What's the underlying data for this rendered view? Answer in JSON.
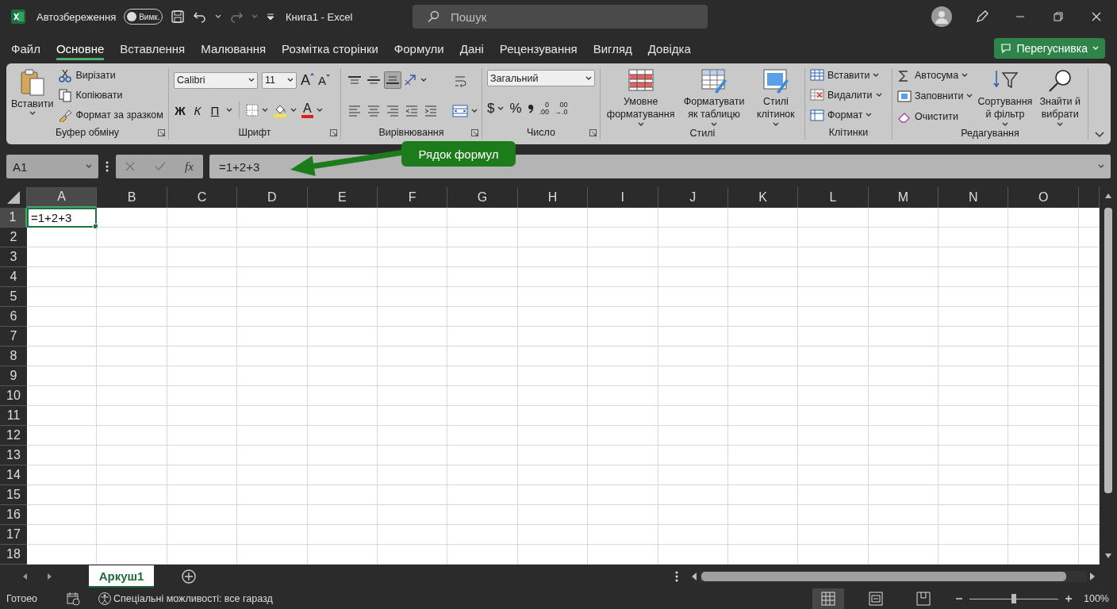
{
  "title_bar": {
    "autosave_label": "Автозбереження",
    "autosave": {
      "label": "Вимк.",
      "on": false
    },
    "title": "Книга1 - Excel",
    "search": {
      "placeholder": "Пошук"
    }
  },
  "menu_tabs": [
    {
      "label": "Файл",
      "selected": false
    },
    {
      "label": "Основне",
      "selected": true
    },
    {
      "label": "Вставлення",
      "selected": false
    },
    {
      "label": "Малювання",
      "selected": false
    },
    {
      "label": "Розмітка сторінки",
      "selected": false
    },
    {
      "label": "Формули",
      "selected": false
    },
    {
      "label": "Дані",
      "selected": false
    },
    {
      "label": "Рецензування",
      "selected": false
    },
    {
      "label": "Вигляд",
      "selected": false
    },
    {
      "label": "Довідка",
      "selected": false
    }
  ],
  "share_button": {
    "label": "Перегуснивка"
  },
  "ribbon": {
    "groups": [
      {
        "kind": "clipboard",
        "label": "Буфер обміну",
        "launcher": true,
        "paste": "Вставити",
        "actions": [
          "Вирізати",
          "Копіювати",
          "Формат за зразком"
        ]
      },
      {
        "kind": "font",
        "label": "Шрифт",
        "launcher": true,
        "font_name": "Calibri",
        "font_size": "11",
        "grow": "A",
        "shrink": "A",
        "styles": [
          "Ж",
          "К",
          "П"
        ],
        "font_color": "A"
      },
      {
        "kind": "alignment",
        "label": "Вирівнювання",
        "launcher": true,
        "vertical": [
          {
            "selected": false
          },
          {
            "selected": false
          },
          {
            "selected": true
          }
        ]
      },
      {
        "kind": "number",
        "label": "Число",
        "launcher": true,
        "format": "Загальний",
        "currency": "$",
        "percent": "%",
        "decimals": [
          "0\n.00",
          "00\n→.0"
        ]
      },
      {
        "kind": "styles",
        "label": "Стилі",
        "launcher": false,
        "buttons": [
          "Умовне форматування",
          "Форматувати як таблицю",
          "Стилі клітинок"
        ]
      },
      {
        "kind": "cells",
        "label": "Клітинки",
        "launcher": false,
        "buttons": [
          "Вставити",
          "Видалити",
          "Формат"
        ]
      },
      {
        "kind": "editing",
        "label": "Редагування",
        "launcher": false,
        "actions": [
          "Автосума",
          "Заповнити",
          "Очистити"
        ],
        "big": [
          "Сортування й фільтр",
          "Знайти й вибрати"
        ]
      }
    ]
  },
  "formula_bar": {
    "name_box": "A1",
    "function_button": "fx",
    "formula": "=1+2+3"
  },
  "callout": {
    "text": "Рядок формул"
  },
  "grid": {
    "columns": [
      {
        "label": "A",
        "selected": true
      },
      {
        "label": "B",
        "selected": false
      },
      {
        "label": "C",
        "selected": false
      },
      {
        "label": "D",
        "selected": false
      },
      {
        "label": "E",
        "selected": false
      },
      {
        "label": "F",
        "selected": false
      },
      {
        "label": "G",
        "selected": false
      },
      {
        "label": "H",
        "selected": false
      },
      {
        "label": "I",
        "selected": false
      },
      {
        "label": "J",
        "selected": false
      },
      {
        "label": "K",
        "selected": false
      },
      {
        "label": "L",
        "selected": false
      },
      {
        "label": "M",
        "selected": false
      },
      {
        "label": "N",
        "selected": false
      },
      {
        "label": "O",
        "selected": false
      }
    ],
    "rows": [
      {
        "label": "1",
        "selected": true,
        "cells": [
          {
            "value": "=1+2+3",
            "selected": true
          }
        ]
      },
      {
        "label": "2",
        "selected": false
      },
      {
        "label": "3",
        "selected": false
      },
      {
        "label": "4",
        "selected": false
      },
      {
        "label": "5",
        "selected": false
      },
      {
        "label": "6",
        "selected": false
      },
      {
        "label": "7",
        "selected": false
      },
      {
        "label": "8",
        "selected": false
      },
      {
        "label": "9",
        "selected": false
      },
      {
        "label": "10",
        "selected": false
      },
      {
        "label": "11",
        "selected": false
      },
      {
        "label": "12",
        "selected": false
      },
      {
        "label": "13",
        "selected": false
      },
      {
        "label": "14",
        "selected": false
      },
      {
        "label": "15",
        "selected": false
      },
      {
        "label": "16",
        "selected": false
      },
      {
        "label": "17",
        "selected": false
      },
      {
        "label": "18",
        "selected": false
      }
    ]
  },
  "sheet_tabs": [
    {
      "label": "Аркуш1",
      "selected": true
    }
  ],
  "status_bar": {
    "status": "Готоео",
    "accessibility": "Спеціальні можливості: все гаразд",
    "views": [
      {
        "kind": "normal",
        "selected": true
      },
      {
        "kind": "page_layout",
        "selected": false
      },
      {
        "kind": "page_break",
        "selected": false
      }
    ],
    "zoom": {
      "level": 0.5,
      "reading": "100%"
    }
  }
}
